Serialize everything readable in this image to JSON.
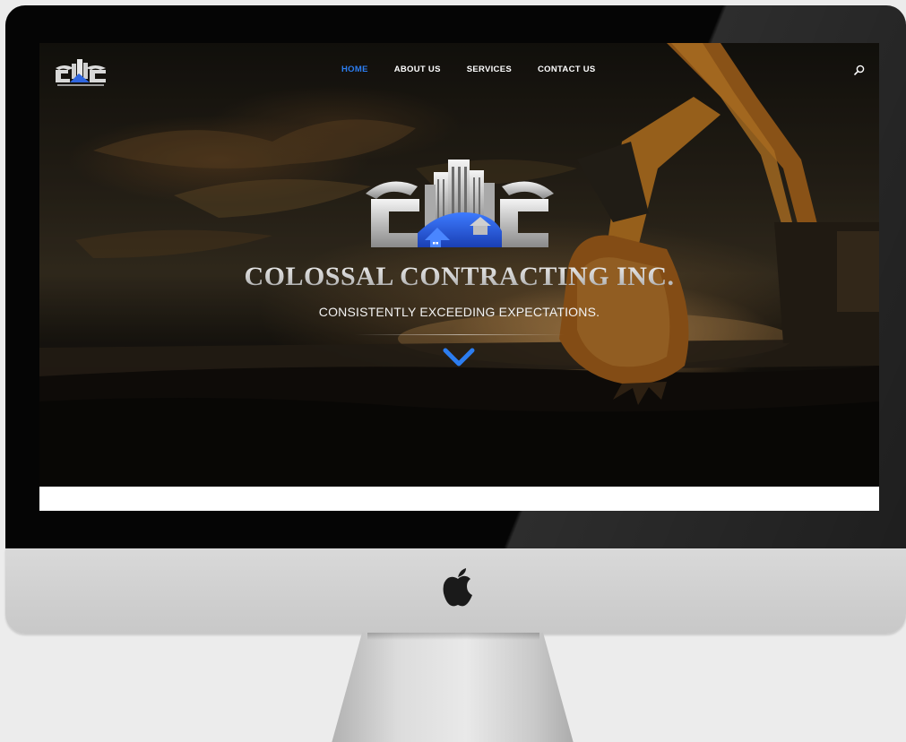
{
  "site": {
    "nav": {
      "items": [
        "HOME",
        "ABOUT US",
        "SERVICES",
        "CONTACT US"
      ],
      "active_index": 0,
      "active_color": "#2c7df0"
    },
    "hero": {
      "title": "COLOSSAL CONTRACTING INC.",
      "tagline": "CONSISTENTLY EXCEEDING EXPECTATIONS."
    },
    "icons": {
      "logo": "ccc-logo",
      "search": "search-icon",
      "scroll": "chevron-down-icon"
    }
  },
  "device": {
    "brand_icon": "apple-logo"
  },
  "colors": {
    "accent": "#2c7df0",
    "bezel": "#050505",
    "chin": "#cfcfcf",
    "page_background": "#ececec"
  }
}
